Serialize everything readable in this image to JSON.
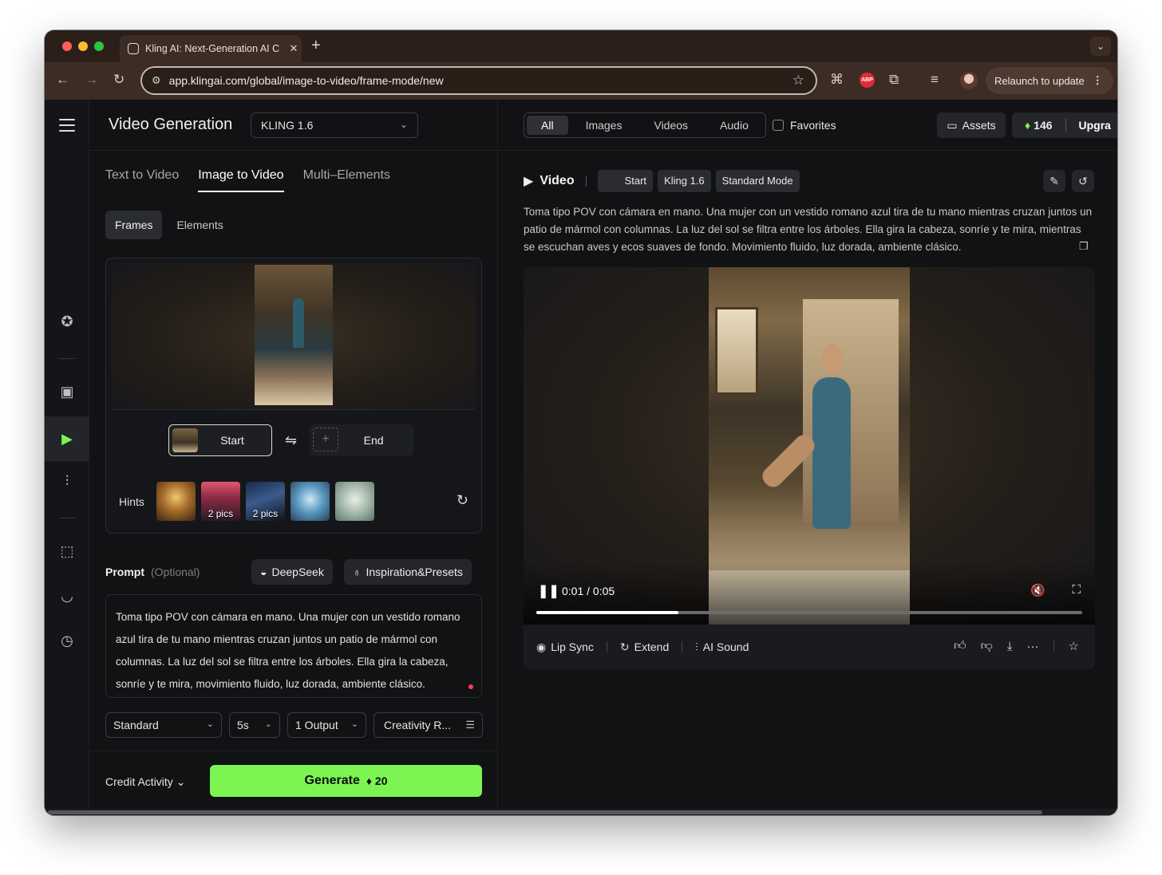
{
  "browser": {
    "tab_title": "Kling AI: Next-Generation AI C",
    "tab_close": "✕",
    "new_tab": "+",
    "url": "app.klingai.com/global/image-to-video/frame-mode/new",
    "relaunch_label": "Relaunch to update",
    "abp_label": "ABP"
  },
  "header": {
    "title": "Video Generation",
    "model": "KLING 1.6"
  },
  "left": {
    "tabs": [
      {
        "label": "Text to Video"
      },
      {
        "label": "Image to Video"
      },
      {
        "label": "Multi–Elements"
      }
    ],
    "subtabs": [
      {
        "label": "Frames"
      },
      {
        "label": "Elements"
      }
    ],
    "start_label": "Start",
    "end_label": "End",
    "hints_label": "Hints",
    "hints": [
      {
        "count": ""
      },
      {
        "count": "2 pics"
      },
      {
        "count": "2 pics"
      },
      {
        "count": ""
      },
      {
        "count": ""
      }
    ],
    "prompt_label": "Prompt",
    "prompt_optional": "(Optional)",
    "deepseek_label": "DeepSeek",
    "inspiration_label": "Inspiration&Presets",
    "prompt_text": "Toma tipo POV con cámara en mano. Una mujer con un vestido romano azul tira de tu mano mientras cruzan juntos un patio de mármol con columnas. La luz del sol se filtra entre los árboles. Ella gira la cabeza, sonríe y te mira, movimiento fluido, luz dorada, ambiente clásico.",
    "selects": {
      "mode": "Standard",
      "duration": "5s",
      "outputs": "1 Output",
      "creativity": "Creativity R..."
    },
    "credit_activity": "Credit Activity",
    "generate_label": "Generate",
    "generate_cost": "20"
  },
  "right": {
    "filters": [
      {
        "label": "All"
      },
      {
        "label": "Images"
      },
      {
        "label": "Videos"
      },
      {
        "label": "Audio"
      }
    ],
    "favorites_label": "Favorites",
    "assets_label": "Assets",
    "credits": "146",
    "upgrade_label": "Upgra",
    "video_title": "Video",
    "tags": {
      "start": "Start",
      "model": "Kling 1.6",
      "mode": "Standard Mode"
    },
    "description": "Toma tipo POV con cámara en mano. Una mujer con un vestido romano azul tira de tu mano mientras cruzan juntos un patio de mármol con columnas. La luz del sol se filtra entre los árboles. Ella gira la cabeza, sonríe y te mira, mientras se escuchan aves y ecos suaves de fondo. Movimiento fluido, luz dorada, ambiente clásico.",
    "player": {
      "time": "0:01 / 0:05",
      "progress": 0.26
    },
    "actions": {
      "lip_sync": "Lip Sync",
      "extend": "Extend",
      "ai_sound": "AI Sound"
    }
  }
}
